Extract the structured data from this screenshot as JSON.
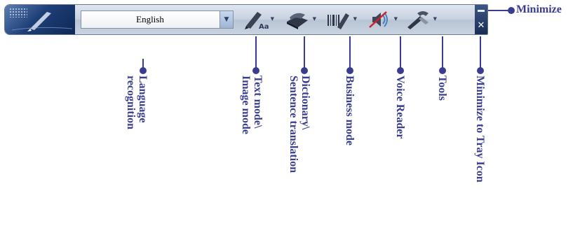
{
  "toolbar": {
    "language_value": "English",
    "tools": [
      {
        "name": "text-image-mode"
      },
      {
        "name": "dictionary"
      },
      {
        "name": "business-mode"
      },
      {
        "name": "voice-reader"
      },
      {
        "name": "tools"
      }
    ]
  },
  "callouts": {
    "language": "Language\nrecognition",
    "text_image": "Text mode\\\nImage mode",
    "dictionary": "Dictionary\\\nSentence translation",
    "business": "Business mode",
    "voice": "Voice Reader",
    "tools": "Tools",
    "tray": "Minimize to Tray Icon",
    "minimize": "Minimize"
  },
  "colors": {
    "callout": "#3a3d8f",
    "logo": "#1f3f78"
  },
  "icons": [
    "pen-logo-icon",
    "text-image-pen-icon",
    "dictionary-scanner-icon",
    "barcode-pen-icon",
    "speaker-muted-icon",
    "tools-icon",
    "minimize-icon",
    "close-icon"
  ]
}
